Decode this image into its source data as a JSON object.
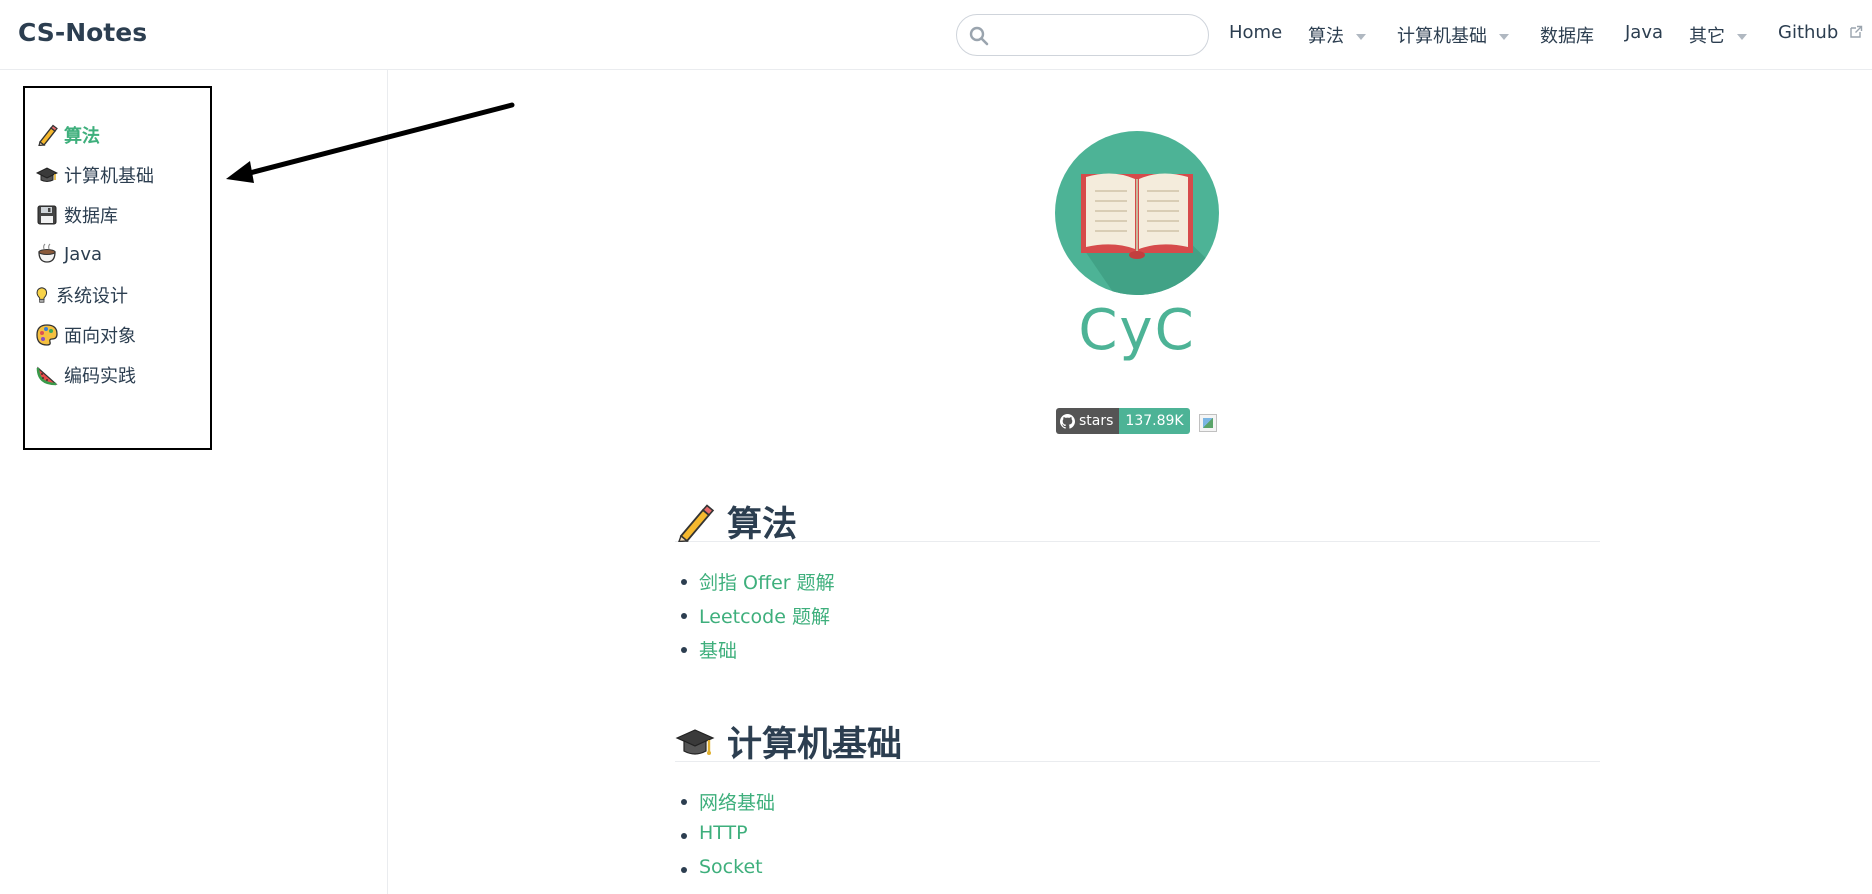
{
  "navbar": {
    "site_title": "CS-Notes",
    "search": {
      "value": "",
      "placeholder": ""
    },
    "items": [
      {
        "label": "Home",
        "dropdown": false
      },
      {
        "label": "算法",
        "dropdown": true
      },
      {
        "label": "计算机基础",
        "dropdown": true
      },
      {
        "label": "数据库",
        "dropdown": false
      },
      {
        "label": "Java",
        "dropdown": false
      },
      {
        "label": "其它",
        "dropdown": true
      },
      {
        "label": "Github",
        "external": true
      }
    ]
  },
  "sidebar": {
    "items": [
      {
        "label": "算法",
        "icon": "pencil-icon",
        "active": true
      },
      {
        "label": "计算机基础",
        "icon": "graduation-cap-icon",
        "active": false
      },
      {
        "label": "数据库",
        "icon": "floppy-disk-icon",
        "active": false
      },
      {
        "label": "Java",
        "icon": "coffee-cup-icon",
        "active": false
      },
      {
        "label": "系统设计",
        "icon": "light-bulb-icon",
        "active": false
      },
      {
        "label": "面向对象",
        "icon": "palette-icon",
        "active": false
      },
      {
        "label": "编码实践",
        "icon": "watermelon-icon",
        "active": false
      }
    ]
  },
  "hero": {
    "logo_text": "CyC",
    "badge": {
      "label": "stars",
      "value": "137.89K"
    }
  },
  "sections": [
    {
      "title": "算法",
      "icon": "pencil-icon",
      "links": [
        "剑指 Offer 题解",
        "Leetcode 题解",
        "基础"
      ]
    },
    {
      "title": "计算机基础",
      "icon": "graduation-cap-icon",
      "links": [
        "网络基础",
        "HTTP",
        "Socket"
      ]
    }
  ],
  "colors": {
    "accent": "#3eaf7c",
    "text": "#2c3e50",
    "logo_circle": "#4db396",
    "badge_dark": "#555555"
  }
}
